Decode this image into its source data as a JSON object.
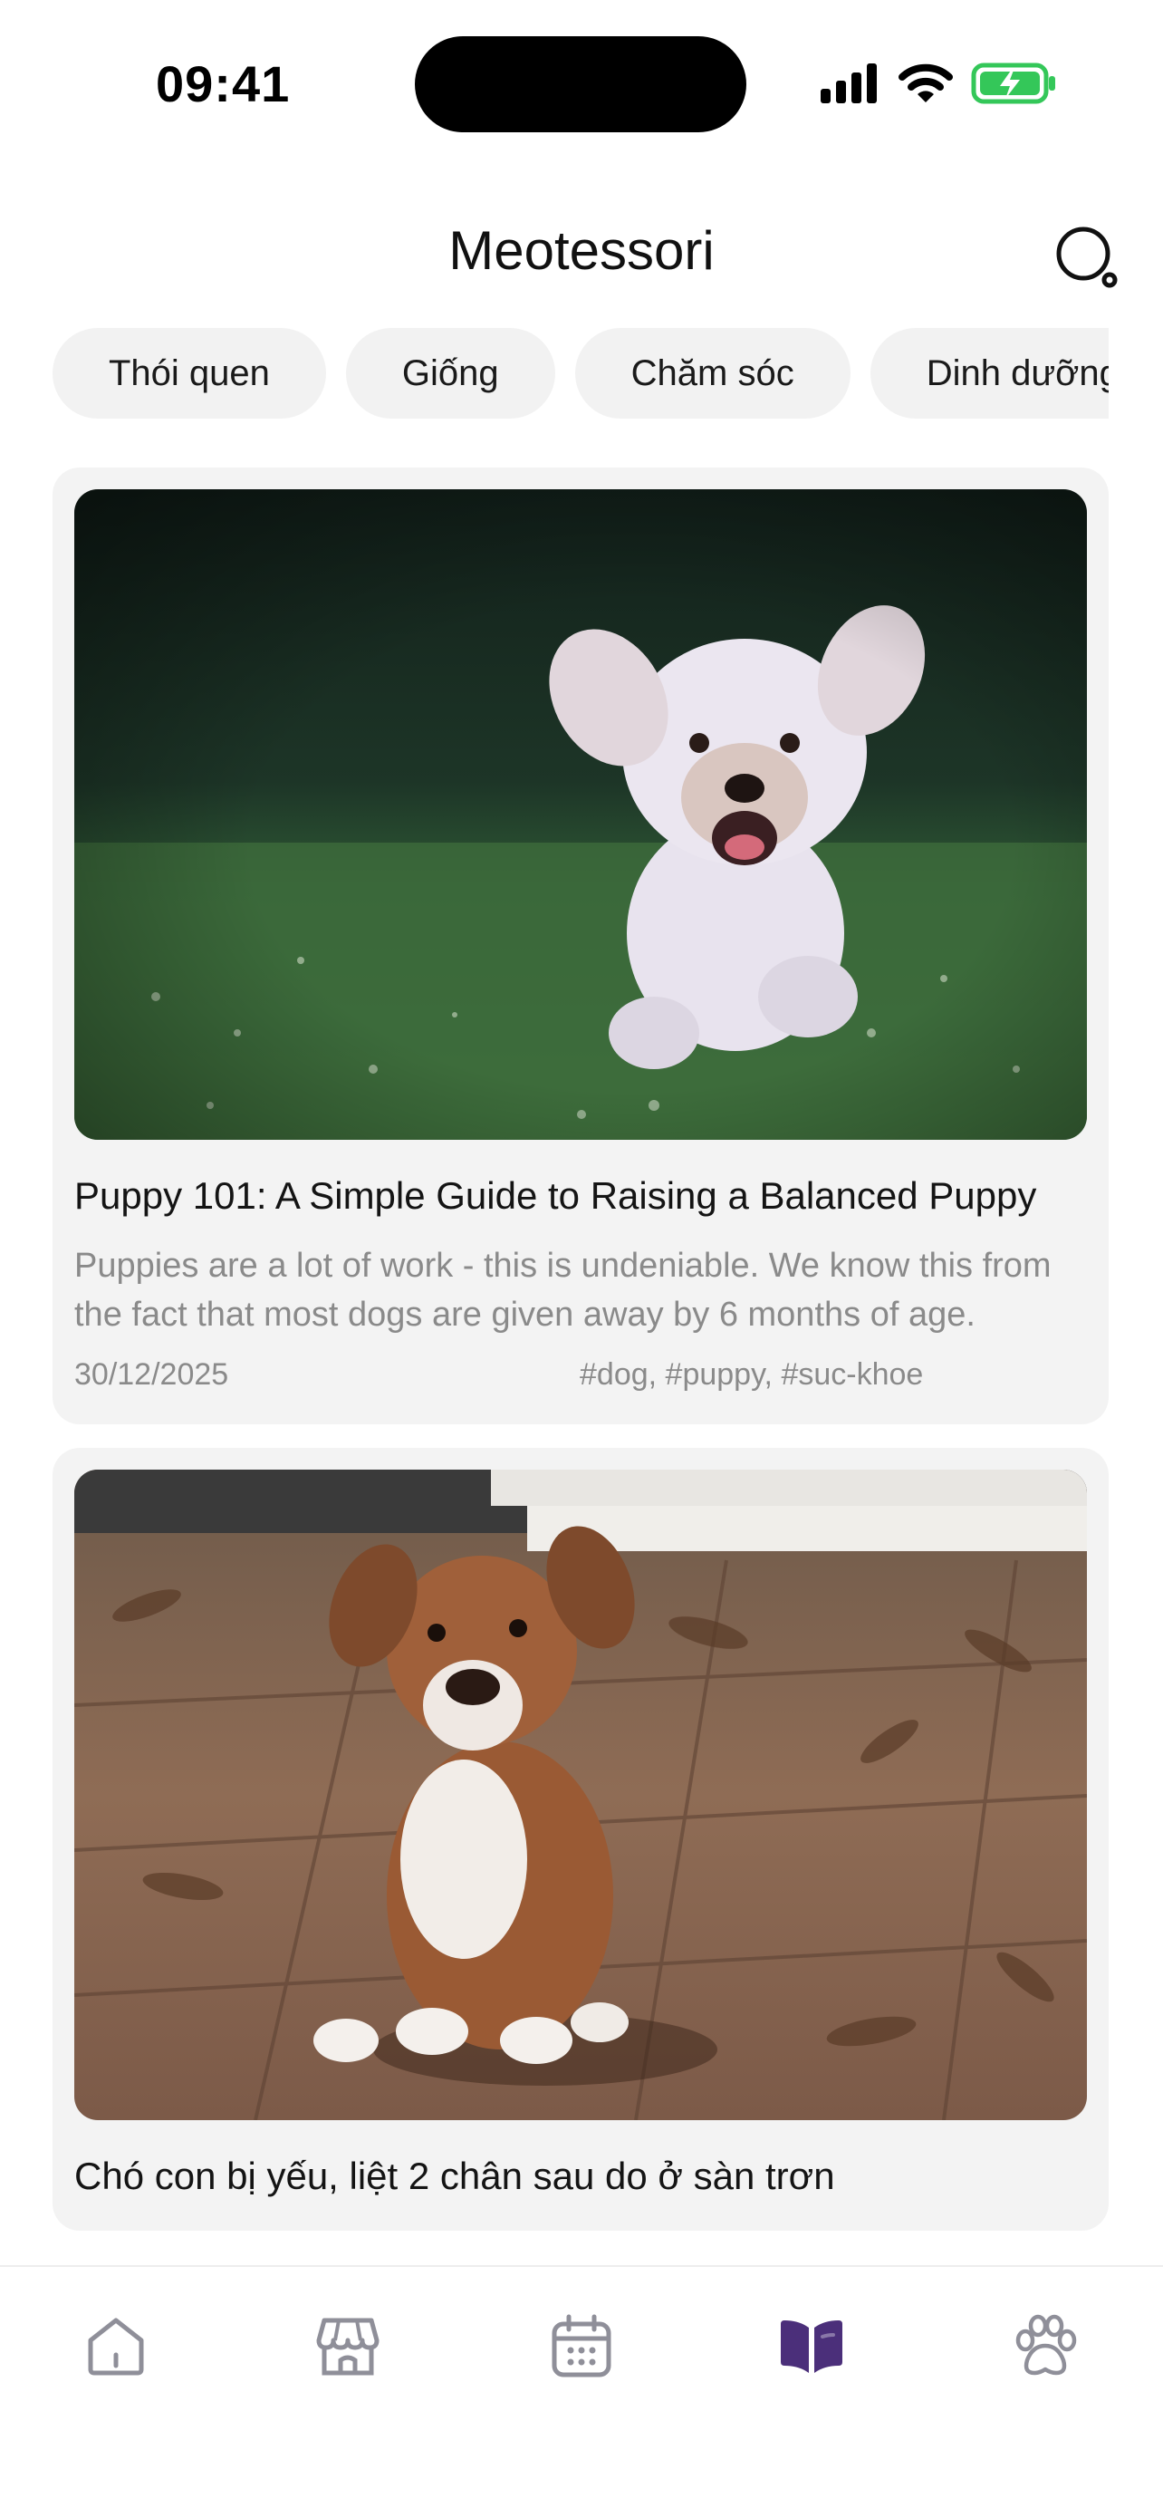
{
  "status_bar": {
    "time": "09:41"
  },
  "header": {
    "title": "Meotessori"
  },
  "categories": [
    "Thói quen",
    "Giống",
    "Chăm sóc",
    "Dinh dưỡng"
  ],
  "articles": [
    {
      "title": "Puppy 101: A Simple Guide to Raising a Balanced Puppy",
      "excerpt": "Puppies are a lot of work - this is undeniable. We know this from the fact that most dogs are given away by 6 months of age.",
      "date": "30/12/2025",
      "tags": "#dog, #puppy, #suc-khoe"
    },
    {
      "title": "Chó con bị yếu, liệt 2 chân sau do ở sàn trơn"
    }
  ],
  "tabbar": {
    "items": [
      "home-icon",
      "shop-icon",
      "calendar-icon",
      "book-icon",
      "paw-icon"
    ],
    "active": "book-icon",
    "active_color": "#4b2f7a",
    "inactive_color": "#8f8f99"
  },
  "colors": {
    "chip_bg": "#f2f2f2",
    "card_bg": "#f3f3f3",
    "muted_text": "#8a8a8a",
    "battery_green": "#34c759"
  }
}
